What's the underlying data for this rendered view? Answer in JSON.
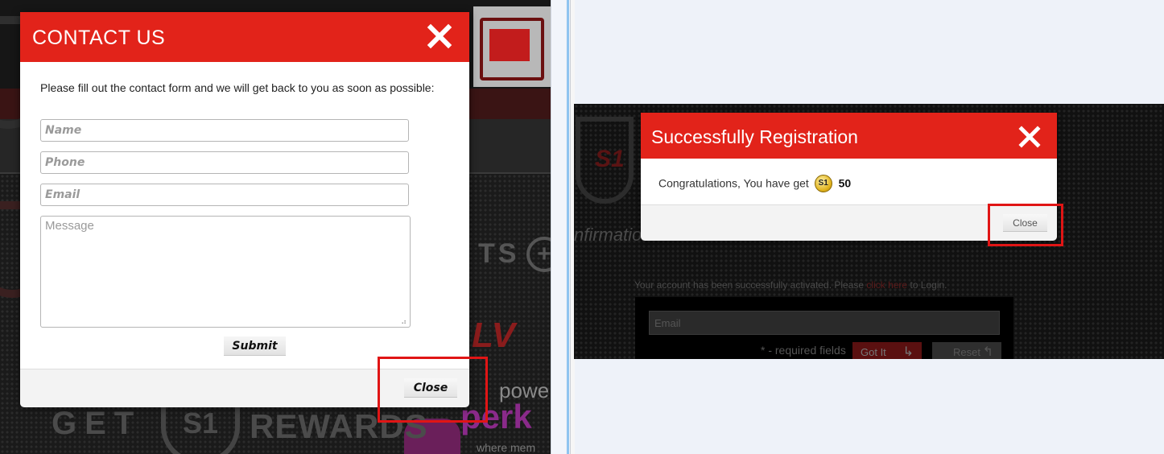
{
  "contact_modal": {
    "title": "CONTACT US",
    "intro": "Please fill out the contact form and we will get back to you as soon as possible:",
    "name_placeholder": "Name",
    "phone_placeholder": "Phone",
    "email_placeholder": "Email",
    "message_placeholder": "Message",
    "submit_label": "Submit",
    "close_label": "Close"
  },
  "background_left": {
    "get": "GET",
    "s1": "S1",
    "rewards": "REWARDS",
    "power": "powe",
    "perks": "perk",
    "where": "where mem",
    "lv": "LV",
    "ts": "TS"
  },
  "success_modal": {
    "title": "Successfully Registration",
    "message": "Congratulations, You have get",
    "coin_label": "S1",
    "amount": "50",
    "close_label": "Close"
  },
  "background_right": {
    "confirmation": "nfirmation Email",
    "activated_text": "Your account has been successfully activated. Please",
    "click_here": "click here",
    "to_login": "to Login.",
    "email_placeholder": "Email",
    "required": "* - required fields",
    "gotit_label": "Got It",
    "reset_label": "Reset"
  },
  "colors": {
    "accent_red": "#e2231a",
    "highlight_red": "#e01515"
  },
  "icons": {
    "close": "close-x-icon",
    "coin": "s1-coin-icon",
    "resize": "resize-grip-icon"
  }
}
